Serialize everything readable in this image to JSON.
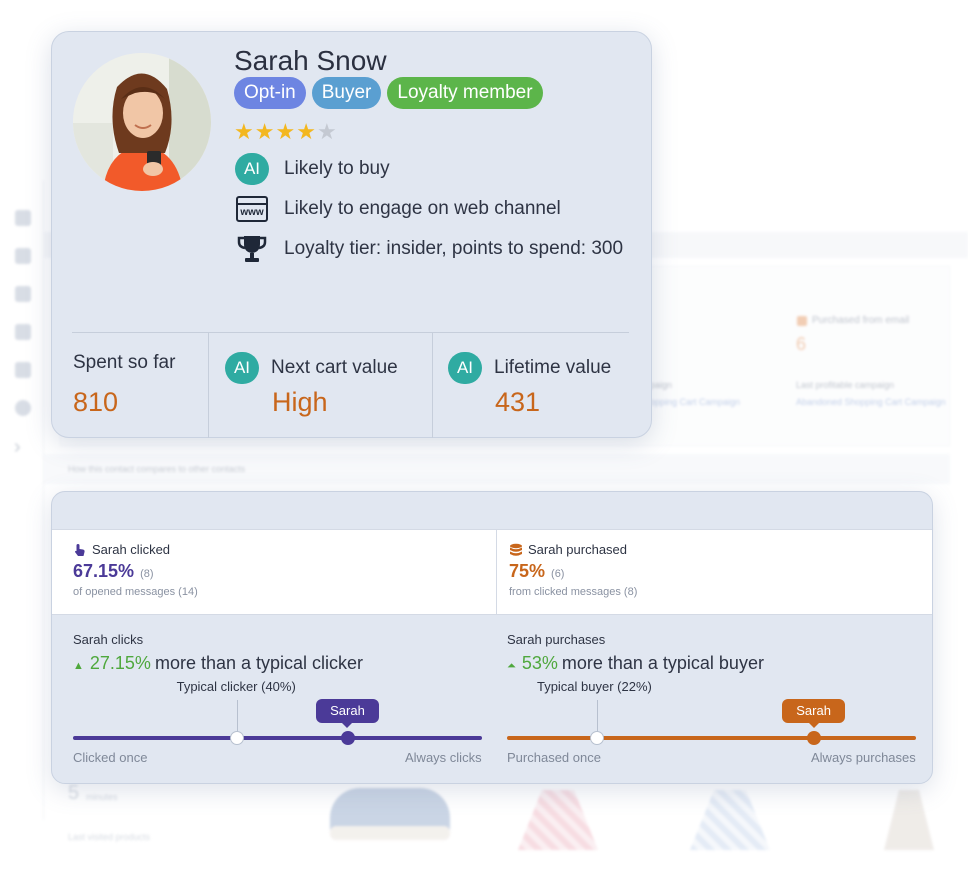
{
  "background": {
    "purchased_from_email_label": "Purchased from email",
    "purchased_from_email_value": "6",
    "last_campaign_label": "Last profitable campaign",
    "last_campaign_link": "Abandoned Shopping Cart Campaign",
    "mid_link": "opping Cart Campaign",
    "mid_label": "paign",
    "compare_caption": "How this contact compares to other contacts",
    "minutes_value": "5",
    "minutes_label": "minutes",
    "last_visited_label": "Last visited products"
  },
  "profile": {
    "name": "Sarah Snow",
    "tags": [
      "Opt-in",
      "Buyer",
      "Loyalty member"
    ],
    "rating": 4,
    "rating_max": 5,
    "ai_badge": "AI",
    "insights": {
      "likely_to_buy": "Likely to buy",
      "web_channel": "Likely to engage on web channel",
      "loyalty": "Loyalty tier: insider, points to spend: 300"
    },
    "www_icon_text": "www",
    "metrics": {
      "spent_label": "Spent so far",
      "spent_value": "810",
      "next_cart_label": "Next cart value",
      "next_cart_value": "High",
      "lifetime_label": "Lifetime value",
      "lifetime_value": "431"
    }
  },
  "comparison": {
    "clicked": {
      "heading": "Sarah clicked",
      "pct": "67.15%",
      "count": "(8)",
      "sub": "of opened messages (14)"
    },
    "purchased": {
      "heading": "Sarah purchased",
      "pct": "75%",
      "count": "(6)",
      "sub": "from clicked messages (8)"
    },
    "clicks": {
      "title": "Sarah clicks",
      "pct": "27.15%",
      "text": "more than a typical clicker",
      "typical_label": "Typical clicker (40%)",
      "typical_level": 0.4,
      "user_level": 0.6715,
      "bubble": "Sarah",
      "start_label": "Clicked once",
      "end_label": "Always clicks",
      "color": "#4b3a98"
    },
    "purchases": {
      "title": "Sarah purchases",
      "pct": "53%",
      "text": "more than a typical buyer",
      "typical_label": "Typical buyer (22%)",
      "typical_level": 0.22,
      "user_level": 0.75,
      "bubble": "Sarah",
      "start_label": "Purchased once",
      "end_label": "Always purchases",
      "color": "#c8661b"
    },
    "increase_color": "#4fa83d"
  }
}
